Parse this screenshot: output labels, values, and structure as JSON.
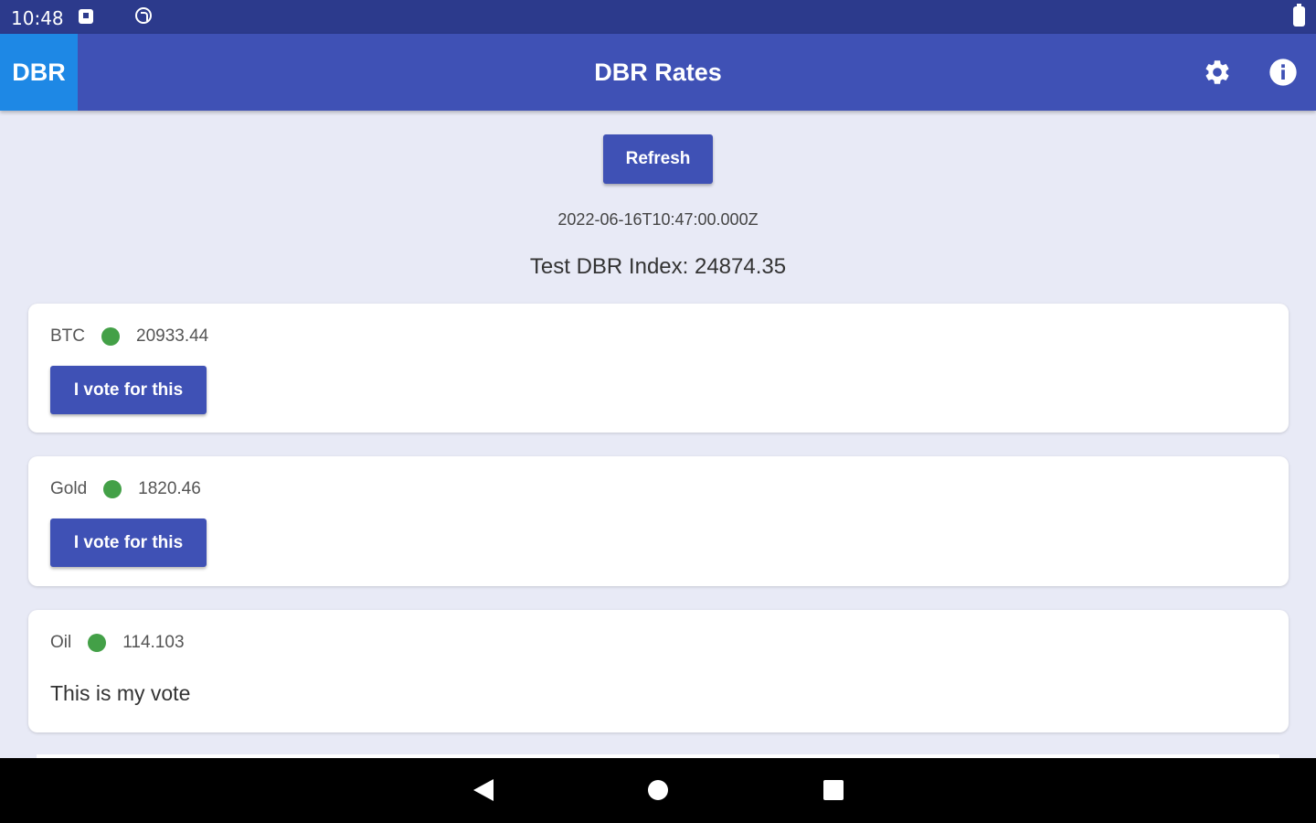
{
  "status_bar": {
    "time": "10:48"
  },
  "app_bar": {
    "logo": "DBR",
    "title": "DBR Rates",
    "icons": [
      "settings-icon",
      "info-icon"
    ]
  },
  "main": {
    "refresh_label": "Refresh",
    "timestamp": "2022-06-16T10:47:00.000Z",
    "index_text": "Test DBR Index: 24874.35",
    "cards": [
      {
        "name": "BTC",
        "value": "20933.44",
        "status_color": "#43a047",
        "action_label": "I vote for this"
      },
      {
        "name": "Gold",
        "value": "1820.46",
        "status_color": "#43a047",
        "action_label": "I vote for this"
      },
      {
        "name": "Oil",
        "value": "114.103",
        "status_color": "#43a047",
        "vote_text": "This is my vote"
      }
    ]
  },
  "colors": {
    "primary": "#3f51b5",
    "logo_bg": "#1e88e5",
    "status_bar": "#2c3a8c",
    "background": "#e8eaf6"
  }
}
